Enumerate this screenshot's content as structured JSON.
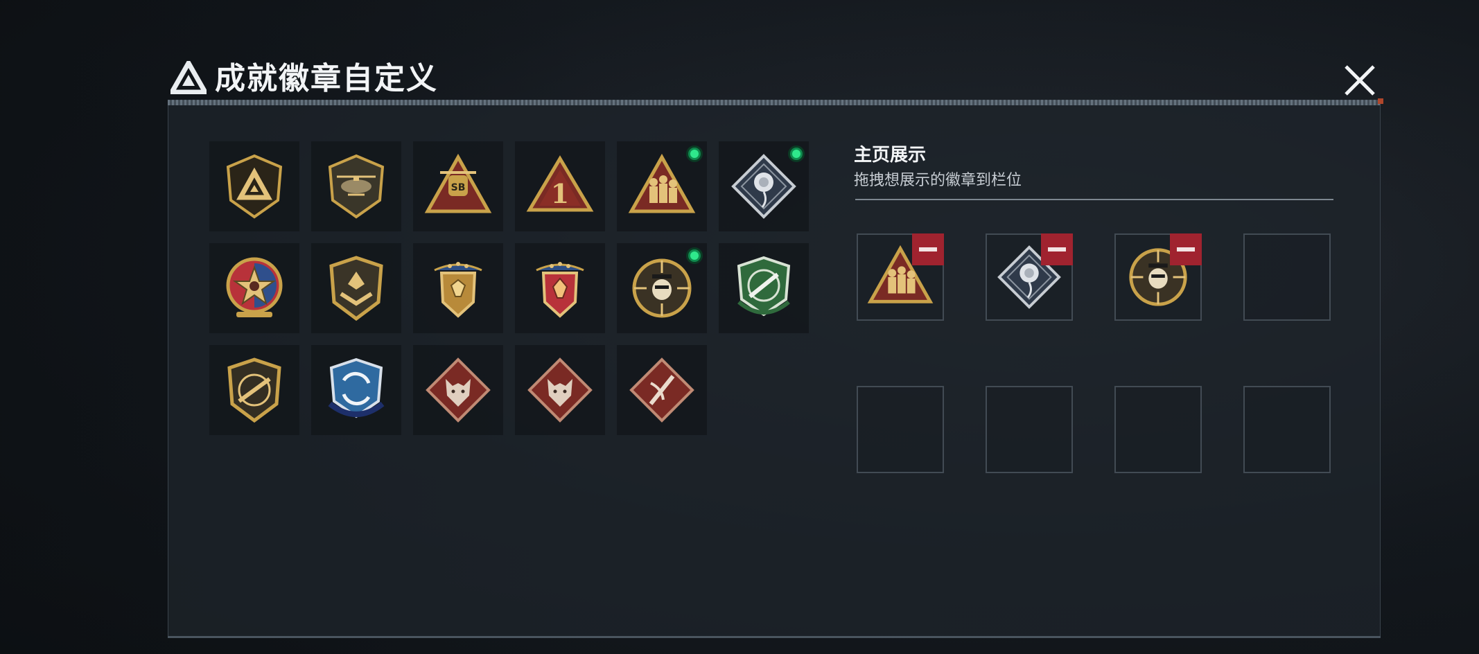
{
  "dialog": {
    "title": "成就徽章自定义",
    "close_icon": "close-icon",
    "logo_icon": "triangle-logo-icon"
  },
  "badges": [
    {
      "icon": "triangle-shield-badge-icon",
      "equipped": false
    },
    {
      "icon": "helicopter-shield-badge-icon",
      "equipped": false
    },
    {
      "icon": "helicopter-triangle-badge-icon",
      "equipped": false
    },
    {
      "icon": "number-one-triangle-badge-icon",
      "equipped": false
    },
    {
      "icon": "soldiers-triangle-badge-icon",
      "equipped": true
    },
    {
      "icon": "rose-diamond-badge-icon",
      "equipped": true
    },
    {
      "icon": "star-medal-badge-icon",
      "equipped": false
    },
    {
      "icon": "chevron-shield-badge-icon",
      "equipped": false
    },
    {
      "icon": "gold-crest-badge-icon",
      "equipped": false
    },
    {
      "icon": "red-crest-badge-icon",
      "equipped": false
    },
    {
      "icon": "skull-crosshair-badge-icon",
      "equipped": true
    },
    {
      "icon": "green-rifle-crest-badge-icon",
      "equipped": false
    },
    {
      "icon": "rifle-shield-badge-icon",
      "equipped": false
    },
    {
      "icon": "blue-arrows-crest-badge-icon",
      "equipped": false
    },
    {
      "icon": "wolf-diamond-badge-icon",
      "equipped": false
    },
    {
      "icon": "wolf-diamond-badge-icon",
      "equipped": false
    },
    {
      "icon": "knife-diamond-badge-icon",
      "equipped": false
    }
  ],
  "display": {
    "title": "主页展示",
    "hint": "拖拽想展示的徽章到栏位",
    "slots": [
      {
        "icon": "soldiers-triangle-badge-icon",
        "filled": true
      },
      {
        "icon": "rose-diamond-badge-icon",
        "filled": true
      },
      {
        "icon": "skull-crosshair-badge-icon",
        "filled": true
      },
      {
        "icon": "",
        "filled": false
      },
      {
        "icon": "",
        "filled": false
      },
      {
        "icon": "",
        "filled": false
      },
      {
        "icon": "",
        "filled": false
      },
      {
        "icon": "",
        "filled": false
      }
    ]
  },
  "colors": {
    "gold": "#c9a24a",
    "equipped": "#2fe88c",
    "remove": "#a0232f",
    "panel_bg": "#1e242a"
  }
}
